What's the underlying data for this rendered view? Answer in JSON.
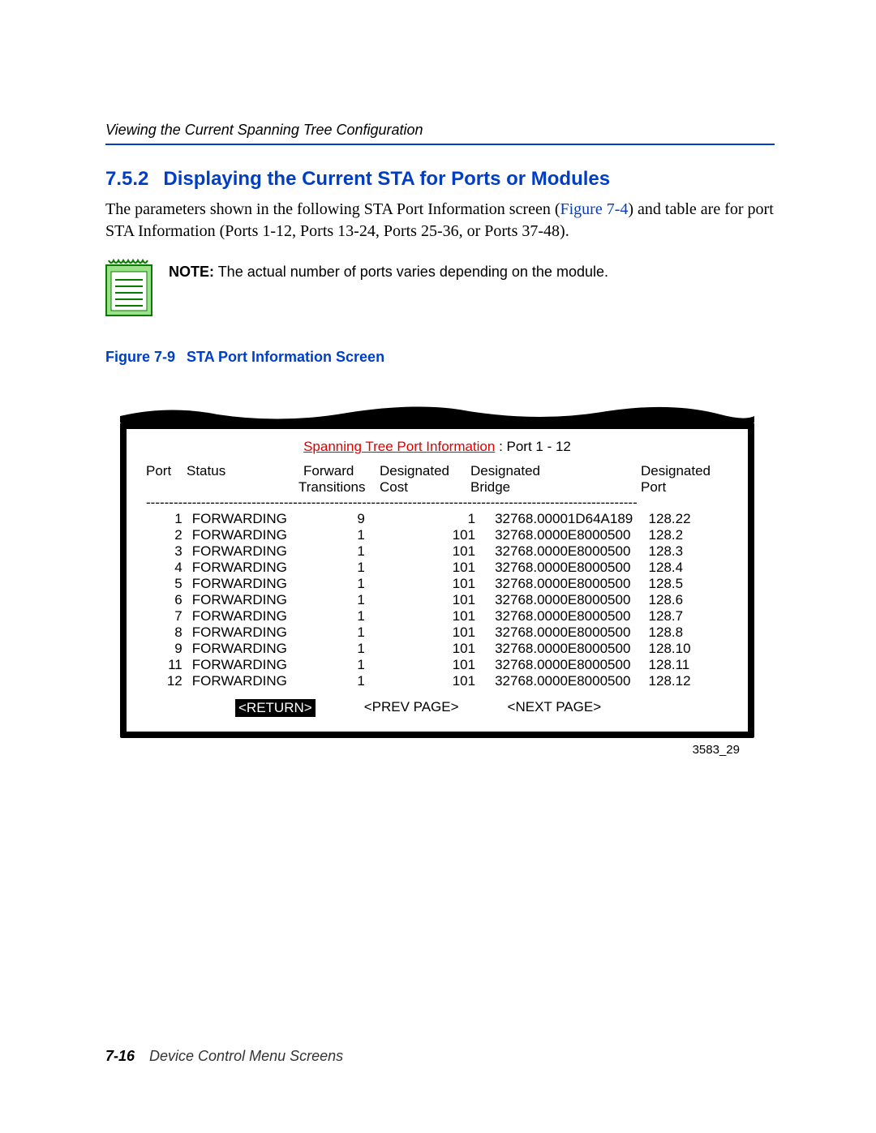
{
  "header": {
    "running_head": "Viewing the Current Spanning Tree Configuration"
  },
  "section": {
    "number": "7.5.2",
    "title": "Displaying the Current STA for Ports or Modules"
  },
  "paragraph": {
    "pre": "The parameters shown in the following STA Port Information screen (",
    "link": "Figure 7-4",
    "post": ") and table are for port STA Information (Ports 1-12, Ports 13-24, Ports 25-36, or Ports 37-48)."
  },
  "note": {
    "label": "NOTE:",
    "text": "The actual number of ports varies depending on the module."
  },
  "figure": {
    "number": "Figure 7-9",
    "title": "STA Port Information Screen",
    "image_id": "3583_29"
  },
  "terminal": {
    "title_red": "Spanning Tree Port Information",
    "title_rest": " : Port  1 - 12",
    "columns": {
      "port_top": "Port",
      "status_top": "Status",
      "fwd_top": "Forward",
      "fwd_bot": "Transitions",
      "cost_top": "Designated",
      "cost_bot": "Cost",
      "bridge_top": "Designated",
      "bridge_bot": "Bridge",
      "dport_top": "Designated",
      "dport_bot": "Port"
    },
    "rows": [
      {
        "port": "1",
        "status": "FORWARDING",
        "fwd": "9",
        "cost": "1",
        "bridge": "32768.00001D64A189",
        "dport": "128.22"
      },
      {
        "port": "2",
        "status": "FORWARDING",
        "fwd": "1",
        "cost": "101",
        "bridge": "32768.0000E8000500",
        "dport": "128.2"
      },
      {
        "port": "3",
        "status": "FORWARDING",
        "fwd": "1",
        "cost": "101",
        "bridge": "32768.0000E8000500",
        "dport": "128.3"
      },
      {
        "port": "4",
        "status": "FORWARDING",
        "fwd": "1",
        "cost": "101",
        "bridge": "32768.0000E8000500",
        "dport": "128.4"
      },
      {
        "port": "5",
        "status": "FORWARDING",
        "fwd": "1",
        "cost": "101",
        "bridge": "32768.0000E8000500",
        "dport": "128.5"
      },
      {
        "port": "6",
        "status": "FORWARDING",
        "fwd": "1",
        "cost": "101",
        "bridge": "32768.0000E8000500",
        "dport": "128.6"
      },
      {
        "port": "7",
        "status": "FORWARDING",
        "fwd": "1",
        "cost": "101",
        "bridge": "32768.0000E8000500",
        "dport": "128.7"
      },
      {
        "port": "8",
        "status": "FORWARDING",
        "fwd": "1",
        "cost": "101",
        "bridge": "32768.0000E8000500",
        "dport": "128.8"
      },
      {
        "port": "9",
        "status": "FORWARDING",
        "fwd": "1",
        "cost": "101",
        "bridge": "32768.0000E8000500",
        "dport": "128.10"
      },
      {
        "port": "11",
        "status": "FORWARDING",
        "fwd": "1",
        "cost": "101",
        "bridge": "32768.0000E8000500",
        "dport": "128.11"
      },
      {
        "port": "12",
        "status": "FORWARDING",
        "fwd": "1",
        "cost": "101",
        "bridge": "32768.0000E8000500",
        "dport": "128.12"
      }
    ],
    "actions": {
      "return": "<RETURN>",
      "prev": "<PREV PAGE>",
      "next": "<NEXT PAGE>"
    }
  },
  "footer": {
    "page": "7-16",
    "title": "Device Control Menu Screens"
  }
}
